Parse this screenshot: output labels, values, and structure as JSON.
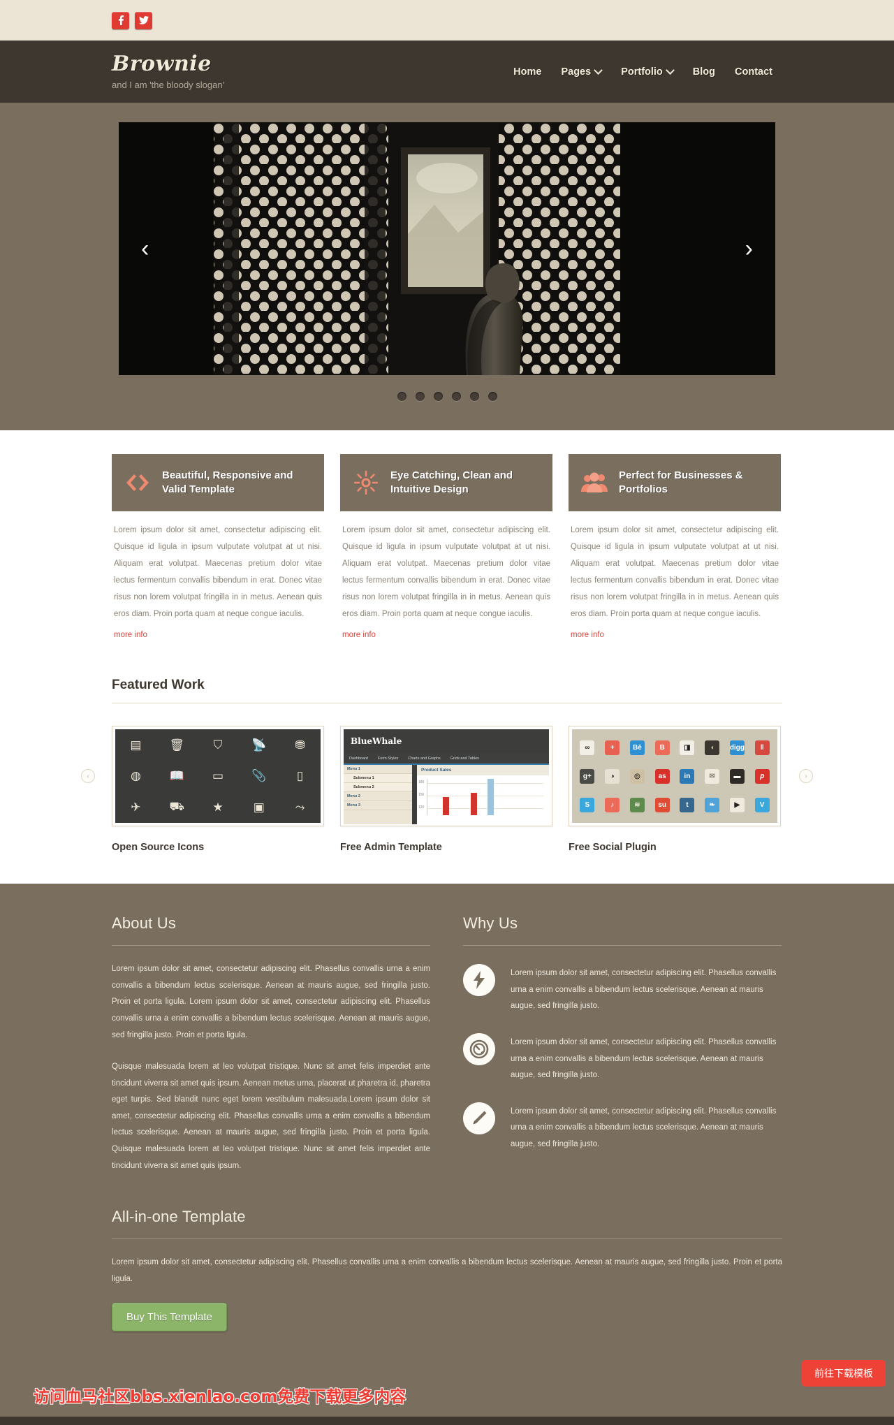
{
  "topbar": {
    "social": [
      {
        "name": "facebook-icon",
        "glyph": "f"
      },
      {
        "name": "twitter-icon",
        "glyph": "t"
      }
    ]
  },
  "header": {
    "brand": "Brownie",
    "slogan": "and I am 'the bloody slogan'",
    "nav": [
      {
        "label": "Home",
        "caret": false
      },
      {
        "label": "Pages",
        "caret": true
      },
      {
        "label": "Portfolio",
        "caret": true
      },
      {
        "label": "Blog",
        "caret": false
      },
      {
        "label": "Contact",
        "caret": false
      }
    ]
  },
  "slider": {
    "prev": "‹",
    "next": "›",
    "dots": 6,
    "active_dot": 0
  },
  "features": [
    {
      "icon": "code-brackets-icon",
      "title": "Beautiful, Responsive and Valid Template",
      "body": "Lorem ipsum dolor sit amet, consectetur adipiscing elit. Quisque id ligula in ipsum vulputate volutpat at ut nisi. Aliquam erat volutpat. Maecenas pretium dolor vitae lectus fermentum convallis bibendum in erat. Donec vitae risus non lorem volutpat fringilla in in metus. Aenean quis eros diam. Proin porta quam at neque congue iaculis.",
      "link": "more info"
    },
    {
      "icon": "sun-icon",
      "title": "Eye Catching, Clean and Intuitive Design",
      "body": "Lorem ipsum dolor sit amet, consectetur adipiscing elit. Quisque id ligula in ipsum vulputate volutpat at ut nisi. Aliquam erat volutpat. Maecenas pretium dolor vitae lectus fermentum convallis bibendum in erat. Donec vitae risus non lorem volutpat fringilla in in metus. Aenean quis eros diam. Proin porta quam at neque congue iaculis.",
      "link": "more info"
    },
    {
      "icon": "people-group-icon",
      "title": "Perfect for Businesses & Portfolios",
      "body": "Lorem ipsum dolor sit amet, consectetur adipiscing elit. Quisque id ligula in ipsum vulputate volutpat at ut nisi. Aliquam erat volutpat. Maecenas pretium dolor vitae lectus fermentum convallis bibendum in erat. Donec vitae risus non lorem volutpat fringilla in in metus. Aenean quis eros diam. Proin porta quam at neque congue iaculis.",
      "link": "more info"
    }
  ],
  "featured_work": {
    "title": "Featured Work",
    "prev_arrow": "‹",
    "next_arrow": "›",
    "items": [
      {
        "caption": "Open Source Icons"
      },
      {
        "caption": "Free Admin Template"
      },
      {
        "caption": "Free Social Plugin"
      }
    ],
    "icon_thumb_glyphs": [
      "💻",
      "🗑",
      "👜",
      "📡",
      "🗂",
      "🌐",
      "📖",
      "🔋",
      "📎",
      "📱",
      "✈",
      "🚚",
      "★",
      "🪪",
      "⛓"
    ],
    "admin_thumb": {
      "brand": "BlueWhale",
      "menu": [
        "Dashboard",
        "Form Styles",
        "Charts and Graphs",
        "Grids and Tables"
      ],
      "sidebar": [
        "Menu 1",
        "Submenu 1",
        "Submenu 2",
        "Menu 2",
        "Menu 3"
      ],
      "panel_title": "Product Sales",
      "chart_labels": [
        "180",
        "156",
        "120"
      ],
      "bars": [
        {
          "value": 148,
          "color": "#d1342c"
        },
        {
          "value": 160,
          "color": "#d1342c"
        },
        {
          "value": 185,
          "color": "#9cc2dc"
        }
      ]
    },
    "social_thumb": [
      {
        "label": "∞",
        "bg": "#f2efe6",
        "fg": "#222"
      },
      {
        "label": "+",
        "bg": "#e8604f",
        "fg": "#fff"
      },
      {
        "label": "Bē",
        "bg": "#2f8fd3",
        "fg": "#fff"
      },
      {
        "label": "B",
        "bg": "#ec6a58",
        "fg": "#fff"
      },
      {
        "label": "◨",
        "bg": "#f2efe6",
        "fg": "#222"
      },
      {
        "label": "◖",
        "bg": "#3b3630",
        "fg": "#d8cfa8"
      },
      {
        "label": "digg",
        "bg": "#2f8fd3",
        "fg": "#fff"
      },
      {
        "label": "‖",
        "bg": "#d7493f",
        "fg": "#fff"
      },
      {
        "label": "g+",
        "bg": "#4a4a46",
        "fg": "#fff"
      },
      {
        "label": "◑",
        "bg": "#e6e1d2",
        "fg": "#222"
      },
      {
        "label": "◎",
        "bg": "#cdc0a5",
        "fg": "#3b3630"
      },
      {
        "label": "as",
        "bg": "#d7312a",
        "fg": "#fff"
      },
      {
        "label": "in",
        "bg": "#2c7ab5",
        "fg": "#fff"
      },
      {
        "label": "✉",
        "bg": "#efeadd",
        "fg": "#8a8276"
      },
      {
        "label": "▬",
        "bg": "#2e2b26",
        "fg": "#fff"
      },
      {
        "label": "𝑝",
        "bg": "#d7312a",
        "fg": "#fff"
      },
      {
        "label": "S",
        "bg": "#3aa7dd",
        "fg": "#fff"
      },
      {
        "label": "♪",
        "bg": "#ec6a58",
        "fg": "#fff"
      },
      {
        "label": "≋",
        "bg": "#5e8a4e",
        "fg": "#e9e4d3"
      },
      {
        "label": "su",
        "bg": "#df4b33",
        "fg": "#fff"
      },
      {
        "label": "t",
        "bg": "#35678f",
        "fg": "#fff"
      },
      {
        "label": "❧",
        "bg": "#4fa3d8",
        "fg": "#fff"
      },
      {
        "label": "▶",
        "bg": "#efeadd",
        "fg": "#222"
      },
      {
        "label": "V",
        "bg": "#3aa7dd",
        "fg": "#fff"
      }
    ]
  },
  "about": {
    "title": "About Us",
    "paragraphs": [
      "Lorem ipsum dolor sit amet, consectetur adipiscing elit. Phasellus convallis urna a enim convallis a bibendum lectus scelerisque. Aenean at mauris augue, sed fringilla justo. Proin et porta ligula. Lorem ipsum dolor sit amet, consectetur adipiscing elit. Phasellus convallis urna a enim convallis a bibendum lectus scelerisque. Aenean at mauris augue, sed fringilla justo. Proin et porta ligula.",
      "Quisque malesuada lorem at leo volutpat tristique. Nunc sit amet felis imperdiet ante tincidunt viverra sit amet quis ipsum. Aenean metus urna, placerat ut pharetra id, pharetra eget turpis. Sed blandit nunc eget lorem vestibulum malesuada.Lorem ipsum dolor sit amet, consectetur adipiscing elit. Phasellus convallis urna a enim convallis a bibendum lectus scelerisque. Aenean at mauris augue, sed fringilla justo. Proin et porta ligula. Quisque malesuada lorem at leo volutpat tristique. Nunc sit amet felis imperdiet ante tincidunt viverra sit amet quis ipsum."
    ]
  },
  "why_us": {
    "title": "Why Us",
    "items": [
      {
        "icon": "lightning-bolt-icon",
        "text": "Lorem ipsum dolor sit amet, consectetur adipiscing elit. Phasellus convallis urna a enim convallis a bibendum lectus scelerisque. Aenean at mauris augue, sed fringilla justo."
      },
      {
        "icon": "gauge-dial-icon",
        "text": "Lorem ipsum dolor sit amet, consectetur adipiscing elit. Phasellus convallis urna a enim convallis a bibendum lectus scelerisque. Aenean at mauris augue, sed fringilla justo."
      },
      {
        "icon": "pencil-icon",
        "text": "Lorem ipsum dolor sit amet, consectetur adipiscing elit. Phasellus convallis urna a enim convallis a bibendum lectus scelerisque. Aenean at mauris augue, sed fringilla justo."
      }
    ]
  },
  "all_in_one": {
    "title": "All-in-one Template",
    "text": "Lorem ipsum dolor sit amet, consectetur adipiscing elit. Phasellus convallis urna a enim convallis a bibendum lectus scelerisque. Aenean at mauris augue, sed fringilla justo. Proin et porta ligula.",
    "button": "Buy This Template"
  },
  "overlay": {
    "watermark": "访问血马社区bbs.xienlao.com免费下载更多内容",
    "download_button": "前往下载模板"
  },
  "colors": {
    "brand_bg": "#3d372f",
    "body_bg": "#7a6e5f",
    "accent": "#ef8a70",
    "link": "#d9453c",
    "buy_green": "#8cb56a",
    "social_red": "#e03b32"
  }
}
